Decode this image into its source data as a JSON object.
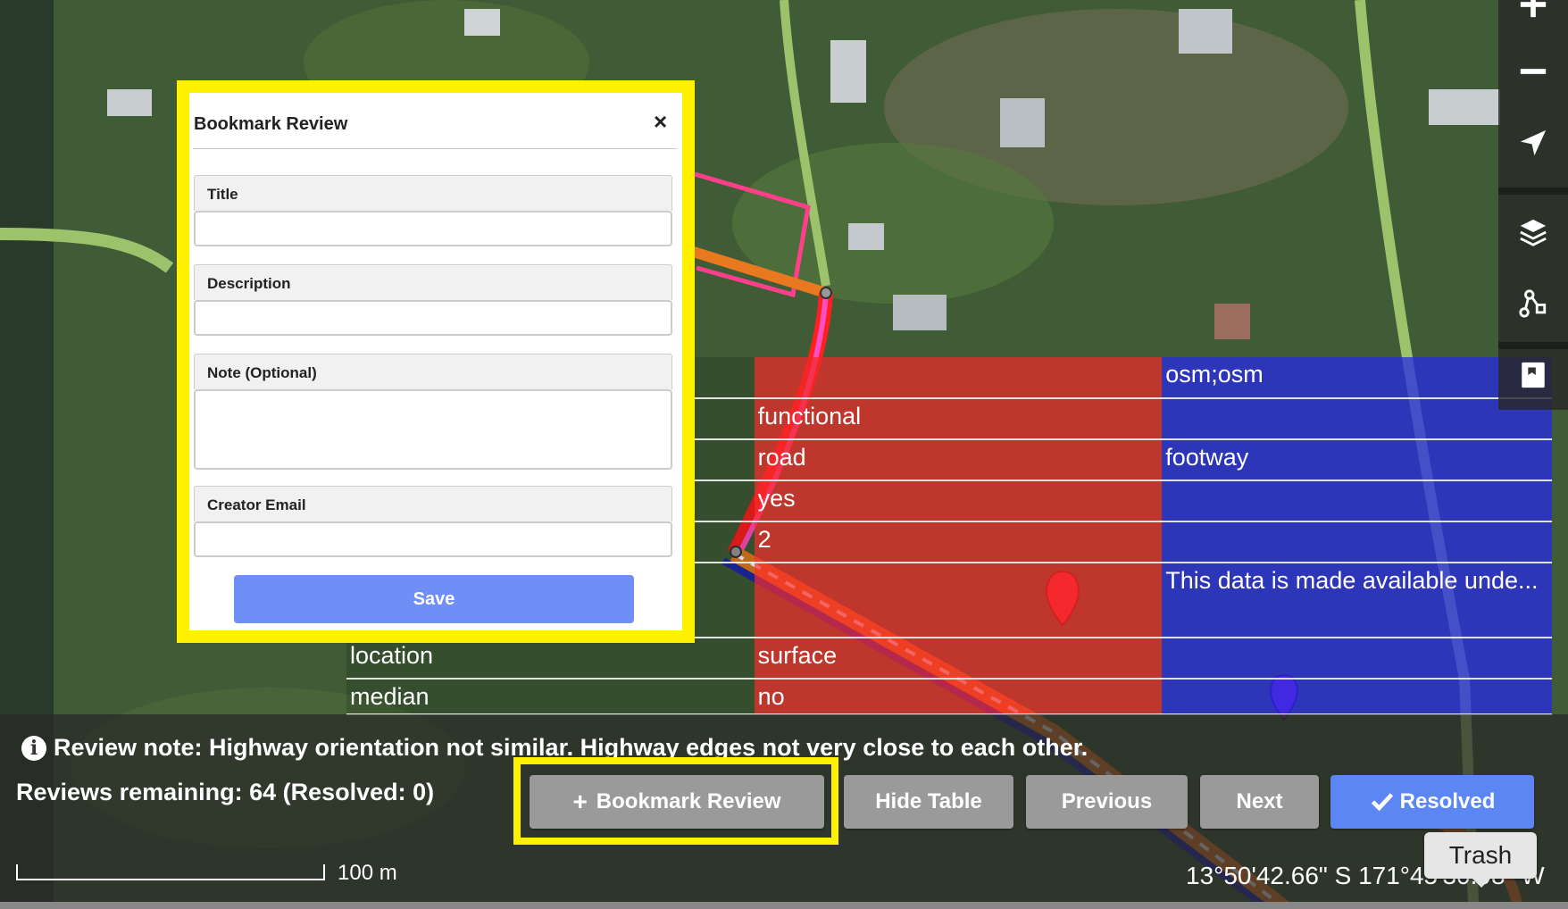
{
  "modal": {
    "title": "Bookmark Review",
    "close_glyph": "×",
    "fields": [
      {
        "label": "Title",
        "value": "",
        "placeholder": ""
      },
      {
        "label": "Description",
        "value": "",
        "placeholder": ""
      },
      {
        "label": "Note (Optional)",
        "value": "",
        "placeholder": ""
      },
      {
        "label": "Creator Email",
        "value": "",
        "placeholder": ""
      }
    ],
    "save_label": "Save"
  },
  "tag_table": {
    "rows": [
      {
        "key": "",
        "a": "",
        "b": "osm;osm"
      },
      {
        "key": "",
        "a": "functional",
        "b": ""
      },
      {
        "key": "",
        "a": "road",
        "b": "footway"
      },
      {
        "key": "",
        "a": "yes",
        "b": ""
      },
      {
        "key": "",
        "a": "2",
        "b": ""
      },
      {
        "key": "",
        "a": "",
        "b": "This data is made available unde..."
      },
      {
        "key": "location",
        "a": "surface",
        "b": ""
      },
      {
        "key": "median",
        "a": "no",
        "b": ""
      }
    ]
  },
  "review": {
    "note": "Review note: Highway orientation not similar. Highway edges not very close to each other.",
    "remaining": "Reviews remaining: 64 (Resolved: 0)",
    "buttons": {
      "bookmark": "Bookmark Review",
      "bookmark_icon": "plus-icon",
      "hide_table": "Hide Table",
      "previous": "Previous",
      "next": "Next",
      "resolved": "Resolved",
      "resolved_icon": "check-icon"
    }
  },
  "map": {
    "scale_label": "100 m",
    "coordinates": "13°50'42.66\" S 171°45'30.98\" W",
    "tooltip": "Trash"
  },
  "controls": [
    {
      "name": "zoom-in",
      "icon": "plus-icon"
    },
    {
      "name": "zoom-out",
      "icon": "minus-icon"
    },
    {
      "name": "geolocate",
      "icon": "location-arrow-icon"
    },
    {
      "name": "layers",
      "icon": "layers-icon"
    },
    {
      "name": "conflation",
      "icon": "nodes-icon"
    },
    {
      "name": "review-bookmarks",
      "icon": "book-icon"
    }
  ],
  "colors": {
    "highlight": "#fff200",
    "resolved_button": "#5b86f4",
    "save_button": "#6f8ff6",
    "table_red": "#f02828",
    "table_blue": "#2828e6"
  }
}
